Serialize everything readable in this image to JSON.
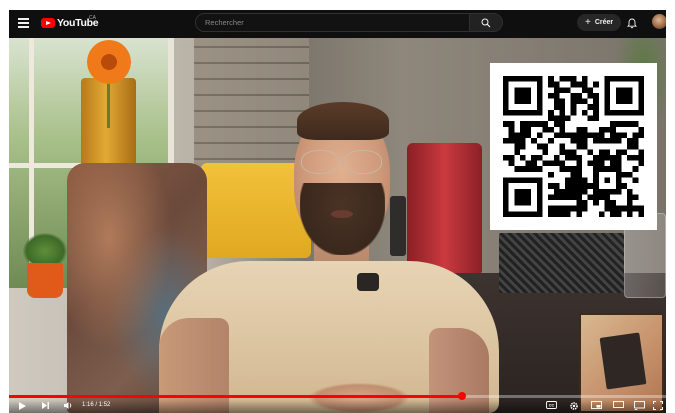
{
  "header": {
    "logo_text": "YouTube",
    "logo_country": "CA",
    "search": {
      "placeholder": "Rechercher",
      "value": ""
    },
    "create_label": "Créer"
  },
  "player": {
    "time_current": "1:16",
    "time_total": "1:52",
    "time_separator": " / ",
    "progress_fraction": 0.69
  },
  "icons": {
    "menu": "hamburger-menu-icon",
    "search": "search-icon",
    "create": "plus-icon",
    "notifications": "bell-icon",
    "play": "play-icon",
    "next": "skip-next-icon",
    "volume": "volume-icon",
    "subtitles": "subtitles-icon",
    "settings": "gear-icon",
    "miniplayer": "miniplayer-icon",
    "theater": "theater-mode-icon",
    "cast": "cast-icon",
    "fullscreen": "fullscreen-icon"
  },
  "colors": {
    "brand_red": "#ff0000",
    "topbar_bg": "#0f0f0f",
    "button_bg": "#272727"
  }
}
